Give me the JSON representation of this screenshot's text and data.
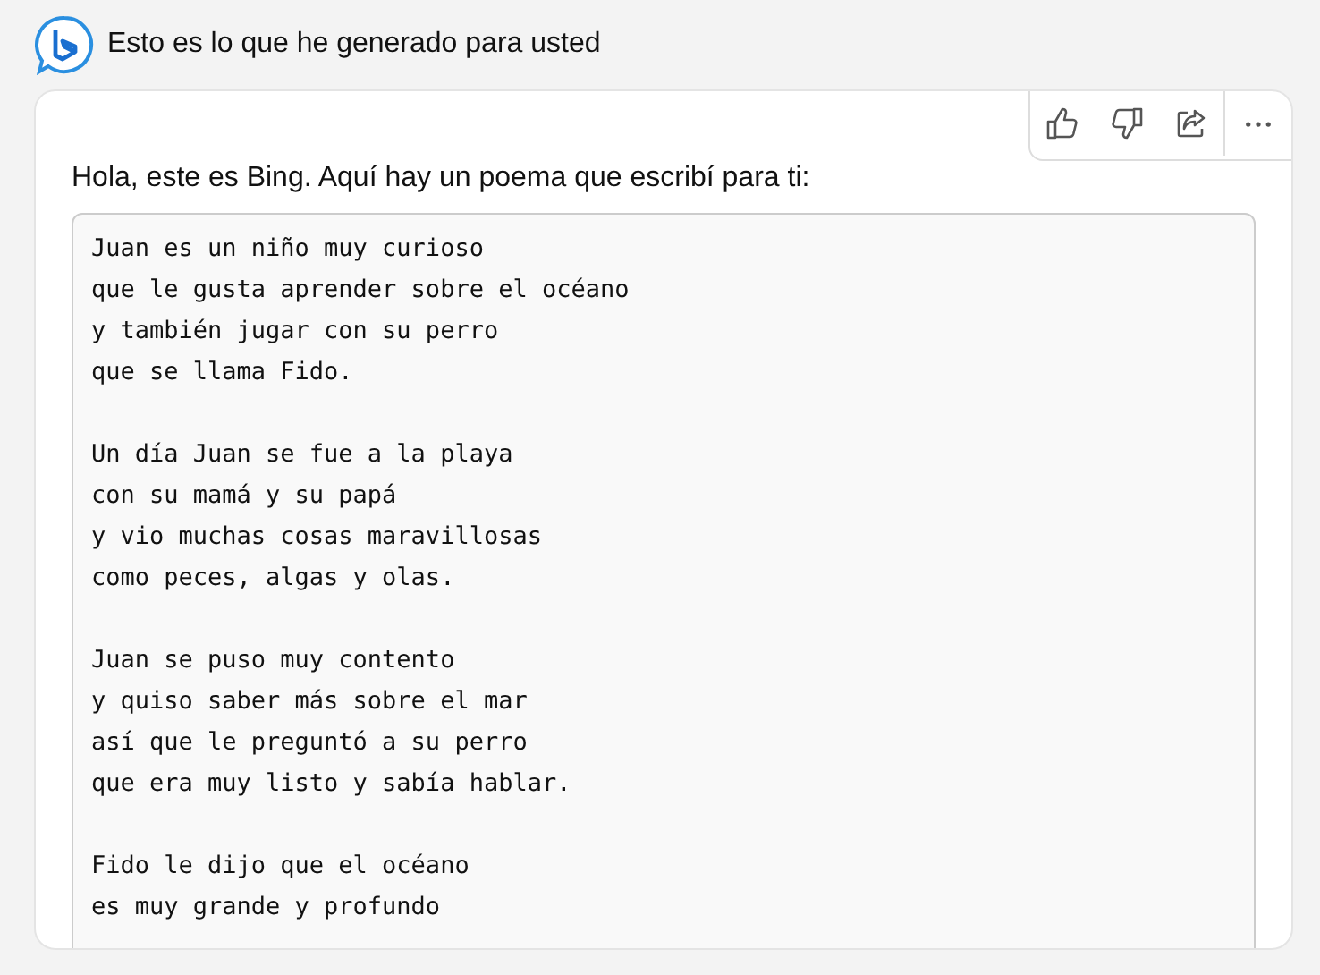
{
  "header": {
    "title": "Esto es lo que he generado para usted"
  },
  "message": {
    "greeting": "Hola, este es Bing. Aquí hay un poema que escribí para ti:",
    "poem": [
      [
        "Juan es un niño muy curioso",
        "que le gusta aprender sobre el océano",
        "y también jugar con su perro",
        "que se llama Fido."
      ],
      [
        "Un día Juan se fue a la playa",
        "con su mamá y su papá",
        "y vio muchas cosas maravillosas",
        "como peces, algas y olas."
      ],
      [
        "Juan se puso muy contento",
        "y quiso saber más sobre el mar",
        "así que le preguntó a su perro",
        "que era muy listo y sabía hablar."
      ],
      [
        "Fido le dijo que el océano",
        "es muy grande y profundo"
      ]
    ]
  }
}
